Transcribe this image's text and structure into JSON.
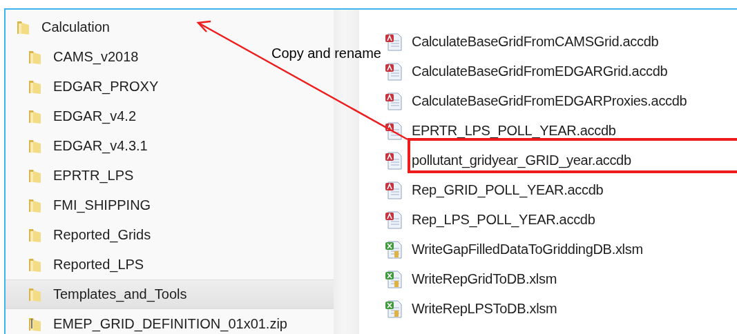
{
  "navigation_tree": [
    {
      "label": "Calculation",
      "kind": "folder",
      "selected": false,
      "children": [
        {
          "label": "CAMS_v2018",
          "kind": "folder",
          "selected": false
        },
        {
          "label": "EDGAR_PROXY",
          "kind": "folder",
          "selected": false
        },
        {
          "label": "EDGAR_v4.2",
          "kind": "folder",
          "selected": false
        },
        {
          "label": "EDGAR_v4.3.1",
          "kind": "folder",
          "selected": false
        },
        {
          "label": "EPRTR_LPS",
          "kind": "folder",
          "selected": false
        },
        {
          "label": "FMI_SHIPPING",
          "kind": "folder",
          "selected": false
        },
        {
          "label": "Reported_Grids",
          "kind": "folder",
          "selected": false
        },
        {
          "label": "Reported_LPS",
          "kind": "folder",
          "selected": false
        },
        {
          "label": "Templates_and_Tools",
          "kind": "folder",
          "selected": true
        },
        {
          "label": "EMEP_GRID_DEFINITION_01x01.zip",
          "kind": "zip",
          "selected": false
        }
      ]
    }
  ],
  "files": [
    {
      "name": "CalculateBaseGridFromCAMSGrid.accdb",
      "kind": "access"
    },
    {
      "name": "CalculateBaseGridFromEDGARGrid.accdb",
      "kind": "access"
    },
    {
      "name": "CalculateBaseGridFromEDGARProxies.accdb",
      "kind": "access"
    },
    {
      "name": "EPRTR_LPS_POLL_YEAR.accdb",
      "kind": "access"
    },
    {
      "name": "pollutant_gridyear_GRID_year.accdb",
      "kind": "access"
    },
    {
      "name": "Rep_GRID_POLL_YEAR.accdb",
      "kind": "access"
    },
    {
      "name": "Rep_LPS_POLL_YEAR.accdb",
      "kind": "access"
    },
    {
      "name": "WriteGapFilledDataToGriddingDB.xlsm",
      "kind": "excel"
    },
    {
      "name": "WriteRepGridToDB.xlsm",
      "kind": "excel"
    },
    {
      "name": "WriteRepLPSToDB.xlsm",
      "kind": "excel"
    }
  ],
  "annotation": {
    "text": "Copy and rename"
  }
}
